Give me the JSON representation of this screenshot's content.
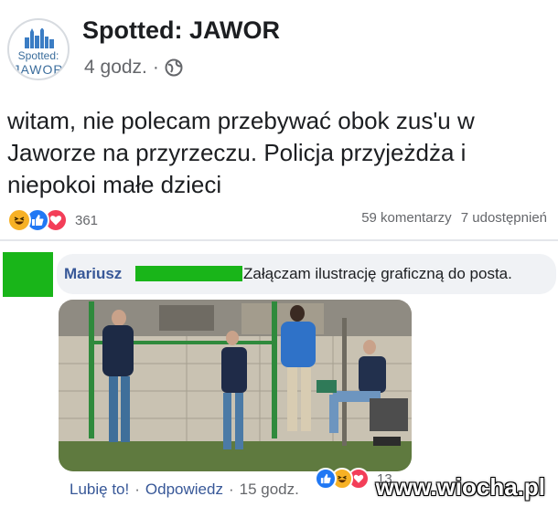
{
  "page": {
    "name": "Spotted: JAWOR",
    "logo_line1": "Spotted:",
    "logo_line2": "JAWOR",
    "time": "4 godz.",
    "separator": "·",
    "visibility_icon": "globe-icon"
  },
  "post": {
    "text_line1": "witam, nie polecam przebywać obok zus'u w",
    "text_line2": "Jaworze na przyrzeczu. Policja przyjeżdża i",
    "text_line3": "niepokoi małe dzieci",
    "reaction_count": "361",
    "reactions": [
      "haha-icon",
      "like-icon",
      "love-icon"
    ],
    "comments": "59 komentarzy",
    "shares": "7 udostępnień"
  },
  "comment": {
    "author": "Mariusz",
    "text": "Załączam ilustrację graficzną do posta.",
    "like_label": "Lubię to!",
    "reply_label": "Odpowiedz",
    "time": "15 godz.",
    "separator": "·",
    "reaction_count": "13",
    "reactions": [
      "like-icon",
      "haha-icon",
      "love-icon"
    ]
  },
  "watermark": "www.wiocha.pl",
  "colors": {
    "redaction_green": "#19b519",
    "facebook_blue": "#385898",
    "like_blue": "#2078f4",
    "love_red": "#f33e58",
    "haha_yellow": "#f7b125"
  }
}
